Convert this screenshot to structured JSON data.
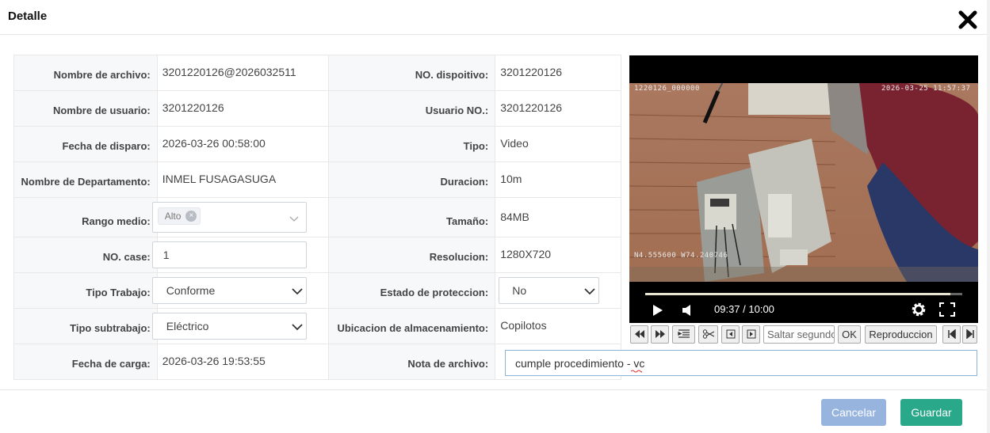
{
  "dialog": {
    "title": "Detalle"
  },
  "fields": {
    "nombre_archivo": {
      "label": "Nombre de archivo:",
      "value": "3201220126@2026032511"
    },
    "no_dispositivo": {
      "label": "NO. dispoitivo:",
      "value": "3201220126"
    },
    "nombre_usuario": {
      "label": "Nombre de usuario:",
      "value": "3201220126"
    },
    "usuario_no": {
      "label": "Usuario NO.:",
      "value": "3201220126"
    },
    "fecha_disparo": {
      "label": "Fecha de disparo:",
      "value": "2026-03-26 00:58:00"
    },
    "tipo": {
      "label": "Tipo:",
      "value": "Video"
    },
    "departamento": {
      "label": "Nombre de Departamento:",
      "value": "INMEL FUSAGASUGA"
    },
    "duracion": {
      "label": "Duracion:",
      "value": "10m"
    },
    "rango_medio": {
      "label": "Rango medio:",
      "tag": "Alto"
    },
    "tamano": {
      "label": "Tamaño:",
      "value": "84MB"
    },
    "no_case": {
      "label": "NO. case:",
      "value": "1"
    },
    "resolucion": {
      "label": "Resolucion:",
      "value": "1280X720"
    },
    "tipo_trabajo": {
      "label": "Tipo Trabajo:",
      "value": "Conforme"
    },
    "estado_proteccion": {
      "label": "Estado de proteccion:",
      "value": "No"
    },
    "tipo_subtrabajo": {
      "label": "Tipo subtrabajo:",
      "value": "Eléctrico"
    },
    "ubicacion": {
      "label": "Ubicacion de almacenamiento:",
      "value": "Copilotos"
    },
    "fecha_carga": {
      "label": "Fecha de carga:",
      "value": "2026-03-26 19:53:55"
    },
    "nota_archivo": {
      "label": "Nota de archivo:",
      "value": "cumple procedimiento - vc"
    }
  },
  "video": {
    "osd_top_left": "1220126_000000",
    "osd_top_right": "2026-03-25  11:57:37",
    "osd_coords": "N4.555600  W74.240746",
    "time": "09:37 / 10:00",
    "progress": 0.962
  },
  "toolbar": {
    "skip_placeholder": "Saltar segundos",
    "ok_label": "OK",
    "play_label": "Reproduccion"
  },
  "buttons": {
    "cancel": "Cancelar",
    "save": "Guardar"
  }
}
